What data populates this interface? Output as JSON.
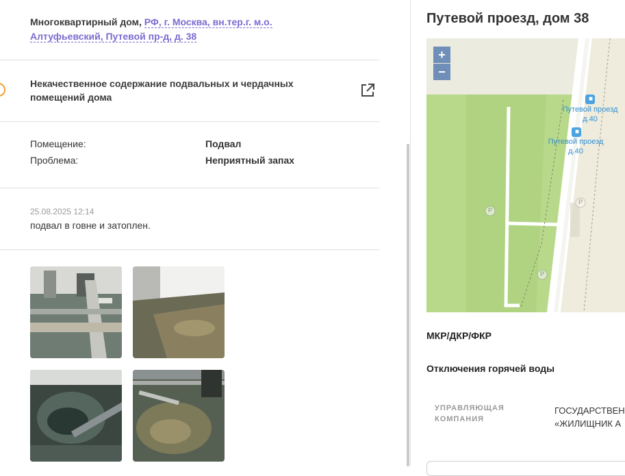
{
  "address": {
    "prefix": "Многоквартирный дом, ",
    "link_line1": "РФ, г. Москва, вн.тер.г. м.о.",
    "link_line2": "Алтуфьевский, Путевой пр-д, д. 38"
  },
  "issue": {
    "title": "Некачественное содержание подвальных и чердачных помещений дома",
    "warning_icon": "exclamation-circle-icon",
    "open_icon": "external-link-icon"
  },
  "details": [
    {
      "label": "Помещение:",
      "value": "Подвал"
    },
    {
      "label": "Проблема:",
      "value": "Неприятный запах"
    }
  ],
  "comment": {
    "date": "25.08.2025 12:14",
    "text": "подвал в говне и затоплен."
  },
  "photos": [
    {
      "name": "photo-1"
    },
    {
      "name": "photo-2"
    },
    {
      "name": "photo-3"
    },
    {
      "name": "photo-4"
    }
  ],
  "right": {
    "title": "Путевой проезд, дом 38",
    "map": {
      "zoom_in": "+",
      "zoom_out": "−",
      "stops": [
        {
          "line1": "Путевой проезд",
          "line2": "д.40"
        },
        {
          "line1": "Путевой проезд",
          "line2": "д.40"
        }
      ],
      "parking": "P"
    },
    "section_repair": "МКР/ДКР/ФКР",
    "section_hot_water": "Отключения горячей воды",
    "management_label_1": "УПРАВЛЯЮЩАЯ",
    "management_label_2": "КОМПАНИЯ",
    "management_value_1": "ГОСУДАРСТВЕН",
    "management_value_2": "«ЖИЛИЩНИК А"
  },
  "colors": {
    "accent": "#7b6bd0",
    "warning": "#f0a030",
    "map_park": "#b9d98a",
    "map_road": "#ffffff"
  }
}
